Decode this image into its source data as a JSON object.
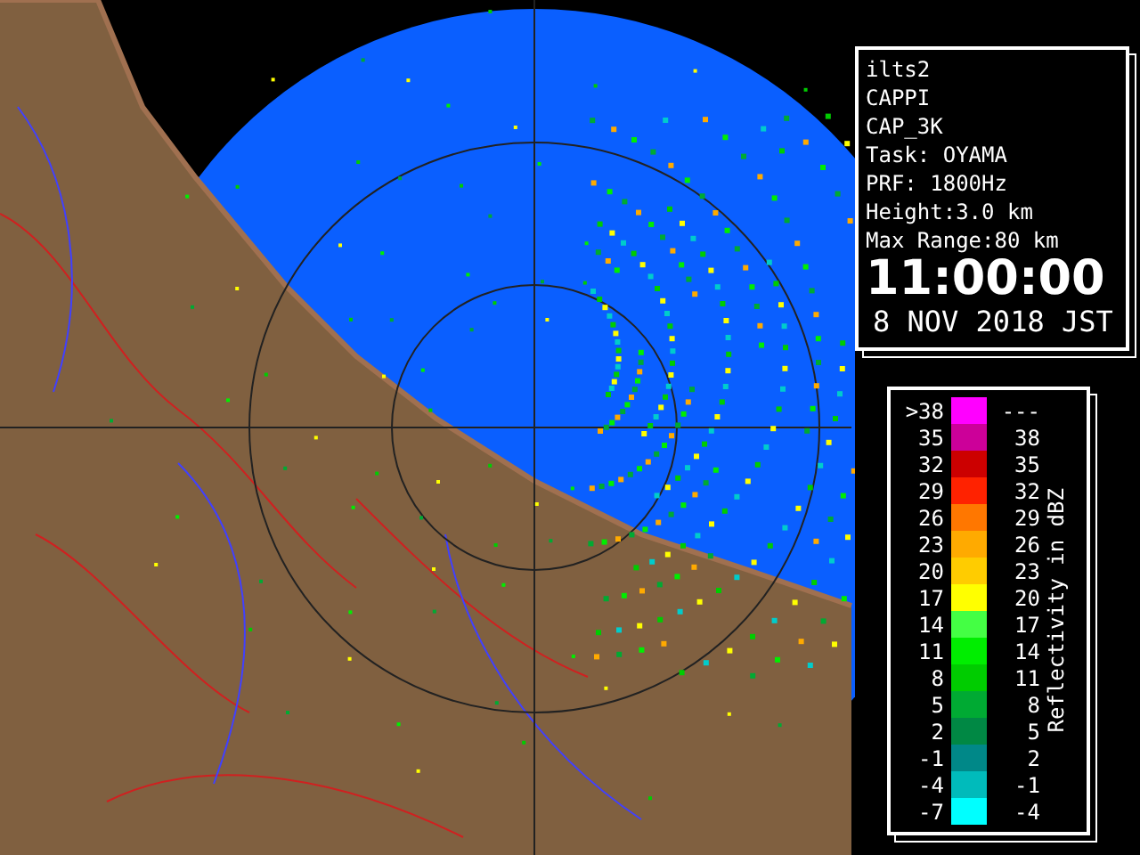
{
  "info_panel": {
    "lines": [
      "ilts2",
      "CAPPI",
      "CAP_3K",
      "Task: OYAMA",
      "PRF: 1800Hz",
      "Height:3.0 km",
      "Max Range:80 km"
    ],
    "time": "11:00:00",
    "date": "8 NOV 2018 JST"
  },
  "legend": {
    "title": "Reflectivity in dBZ",
    "rows": [
      {
        "low": ">38",
        "high": "---",
        "color": "#ff00ff"
      },
      {
        "low": "35",
        "high": "38",
        "color": "#cc0099"
      },
      {
        "low": "32",
        "high": "35",
        "color": "#cc0000"
      },
      {
        "low": "29",
        "high": "32",
        "color": "#ff2200"
      },
      {
        "low": "26",
        "high": "29",
        "color": "#ff7700"
      },
      {
        "low": "23",
        "high": "26",
        "color": "#ffaa00"
      },
      {
        "low": "20",
        "high": "23",
        "color": "#ffcc00"
      },
      {
        "low": "17",
        "high": "20",
        "color": "#ffff00"
      },
      {
        "low": "14",
        "high": "17",
        "color": "#44ff44"
      },
      {
        "low": "11",
        "high": "14",
        "color": "#00ee00"
      },
      {
        "low": "8",
        "high": "11",
        "color": "#00cc00"
      },
      {
        "low": "5",
        "high": "8",
        "color": "#00aa33"
      },
      {
        "low": "2",
        "high": "5",
        "color": "#008844"
      },
      {
        "low": "-1",
        "high": "2",
        "color": "#008888"
      },
      {
        "low": "-4",
        "high": "-1",
        "color": "#00bbbb"
      },
      {
        "low": "-7",
        "high": "-4",
        "color": "#00ffff"
      }
    ]
  }
}
